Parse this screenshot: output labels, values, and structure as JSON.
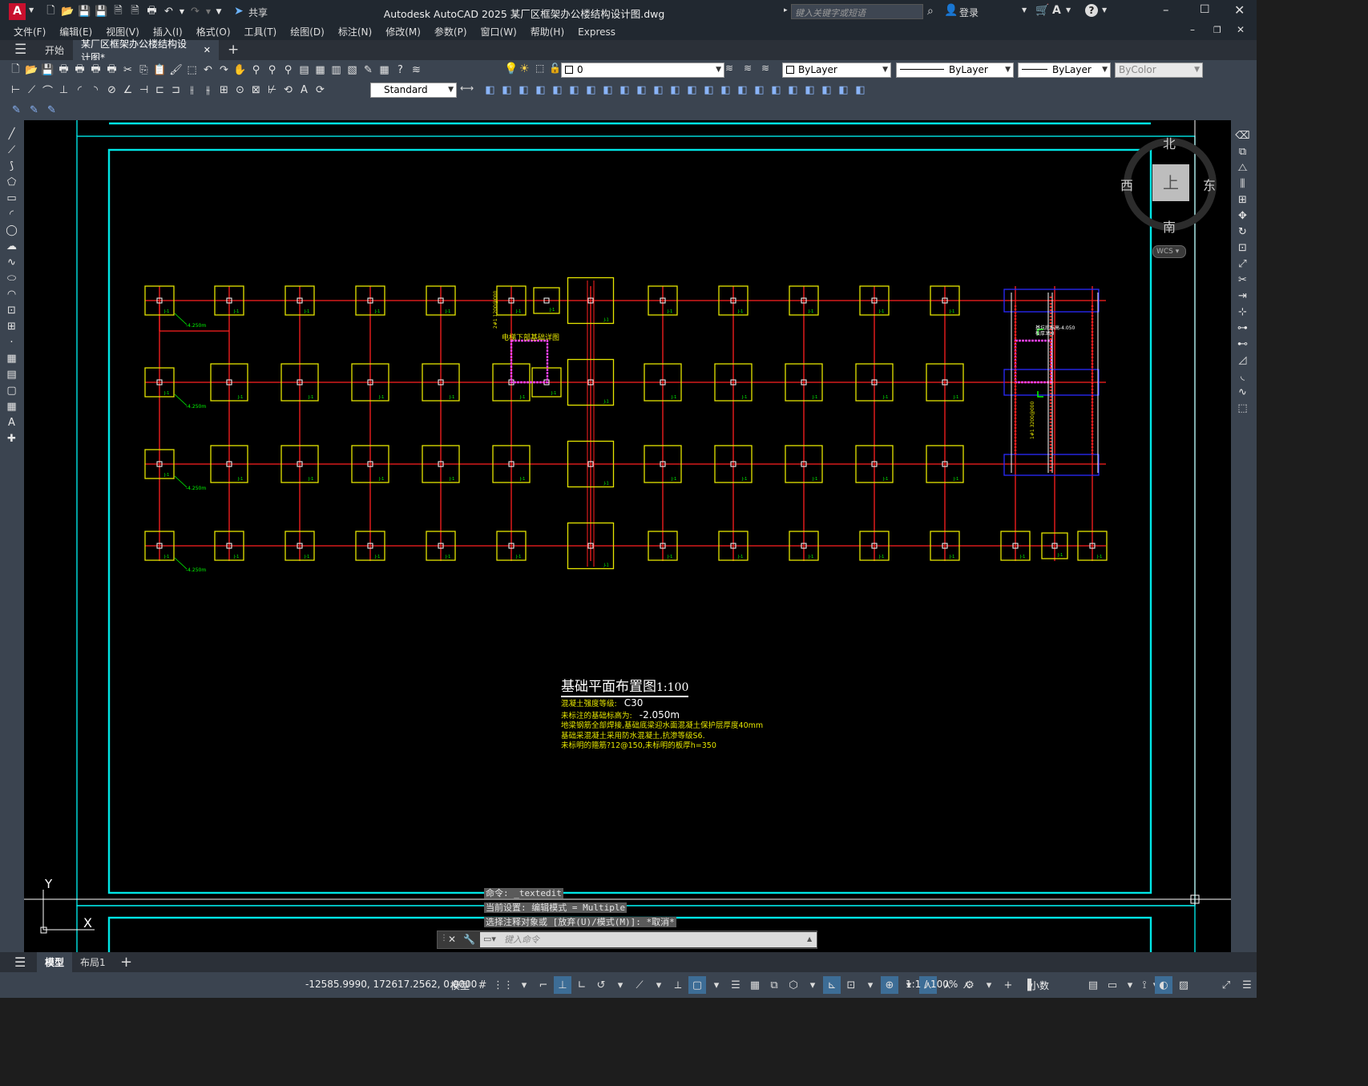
{
  "titlebar": {
    "app_icon_letter": "A",
    "share_label": "共享",
    "title": "Autodesk AutoCAD 2025    某厂区框架办公楼结构设计图.dwg",
    "search_placeholder": "键入关键字或短语",
    "login_label": "登录"
  },
  "menu": [
    "文件(F)",
    "编辑(E)",
    "视图(V)",
    "插入(I)",
    "格式(O)",
    "工具(T)",
    "绘图(D)",
    "标注(N)",
    "修改(M)",
    "参数(P)",
    "窗口(W)",
    "帮助(H)",
    "Express"
  ],
  "doc_tabs": {
    "start": "开始",
    "active": "某厂区框架办公楼结构设计图*"
  },
  "properties": {
    "layer": "0",
    "color": "ByLayer",
    "linetype": "ByLayer",
    "lineweight": "ByLayer",
    "plotstyle": "ByColor",
    "text_style": "Standard"
  },
  "viewcube": {
    "north": "北",
    "south": "南",
    "east": "东",
    "west": "西",
    "face": "上",
    "wcs": "WCS"
  },
  "ucs": {
    "y": "Y",
    "x": "X"
  },
  "drawing": {
    "title": "基础平面布置图",
    "scale": "1:100",
    "notes": [
      {
        "label": "混凝土强度等级:",
        "value": "C30"
      },
      {
        "label": "未标注的基础标高为:",
        "value": "-2.050m"
      },
      {
        "label": "地梁钢筋全部焊接,基础底梁迎水面混凝土保护层厚度40mm",
        "value": ""
      },
      {
        "label": "基础采混凝土采用防水混凝土,抗渗等级S6.",
        "value": ""
      },
      {
        "label": "未标明的箍筋?12@150,未标明的板厚h=350",
        "value": ""
      }
    ],
    "callout": "电梯下部基础详图",
    "elev_tag": "-4.250m",
    "footing_tag": "J-1",
    "right_note1": "基坑底标高-4.050",
    "right_note2": "板厚350"
  },
  "command": {
    "history": [
      "命令: _textedit",
      "当前设置: 编辑模式 = Multiple",
      "选择注释对象或 [放弃(U)/模式(M)]: *取消*"
    ],
    "placeholder": "键入命令"
  },
  "layout_tabs": [
    "模型",
    "布局1"
  ],
  "status": {
    "coords": "-12585.9990, 172617.2562, 0.0000",
    "model": "模型",
    "scale": "1:1 / 100%",
    "units": "小数"
  },
  "colors": {
    "bg": "#000000",
    "frame": "#00e5e5",
    "grid": "#ff2020",
    "footing": "#e5e500",
    "note": "#e5e500",
    "text": "#ffffff",
    "magenta": "#ff40ff",
    "blue": "#2a2aff",
    "green": "#00ff00"
  }
}
